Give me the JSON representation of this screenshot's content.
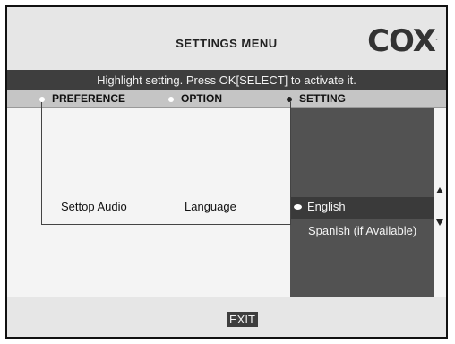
{
  "header": {
    "title": "SETTINGS MENU",
    "logo_text": "COX",
    "logo_mark": "."
  },
  "instruction": "Highlight setting. Press OK[SELECT] to activate it.",
  "columns": [
    {
      "label": "PREFERENCE",
      "marker": "light"
    },
    {
      "label": "OPTION",
      "marker": "light"
    },
    {
      "label": "SETTING",
      "marker": "dark"
    }
  ],
  "row": {
    "preference": "Settop Audio",
    "option": "Language"
  },
  "settings": {
    "selected_index": 0,
    "items": [
      "English",
      "Spanish (if Available)"
    ]
  },
  "scroll": {
    "up_icon": "arrow-up-icon",
    "down_icon": "arrow-down-icon"
  },
  "footer": {
    "exit_label": "EXIT"
  },
  "colors": {
    "instruction_bar": "#3e3e3e",
    "setting_panel": "#525252",
    "selected_row": "#3a3a3a"
  }
}
